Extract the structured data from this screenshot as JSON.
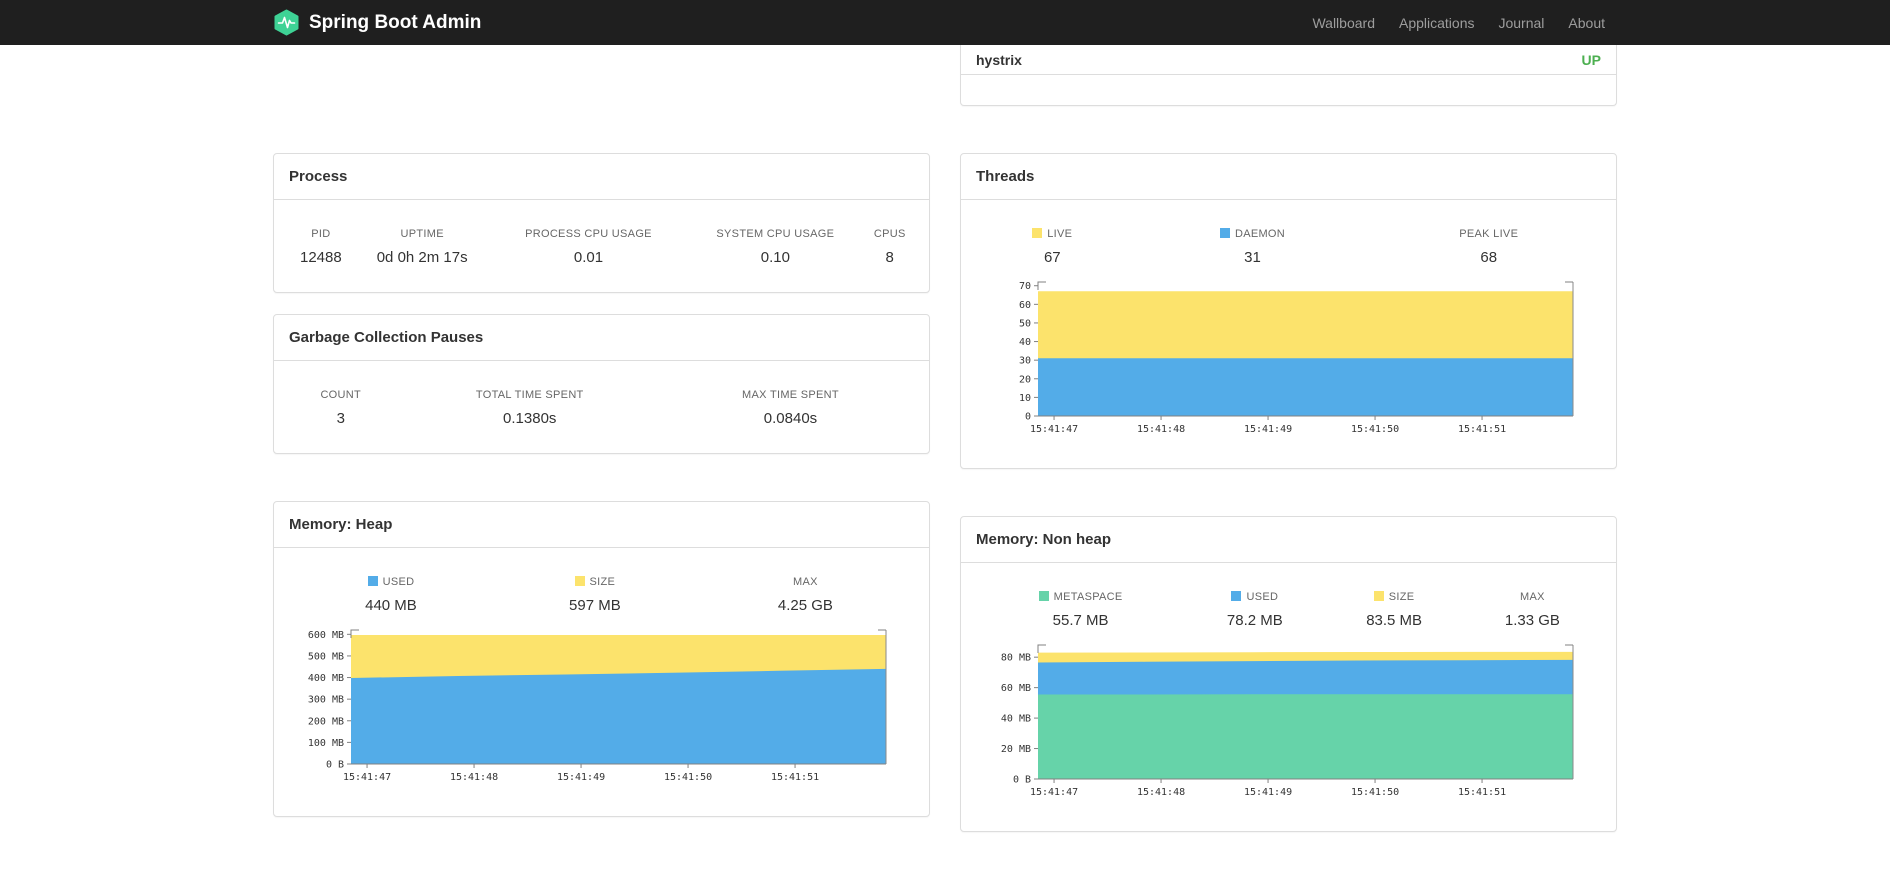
{
  "navbar": {
    "brand": "Spring Boot Admin",
    "brand_color": "#3ed295",
    "items": [
      {
        "label": "Wallboard"
      },
      {
        "label": "Applications"
      },
      {
        "label": "Journal"
      },
      {
        "label": "About"
      }
    ]
  },
  "hystrix_panel": {
    "app_name": "hystrix",
    "status": "UP",
    "status_color": "#4caf50"
  },
  "process": {
    "title": "Process",
    "columns": [
      "PID",
      "UPTIME",
      "PROCESS CPU USAGE",
      "SYSTEM CPU USAGE",
      "CPUS"
    ],
    "values": [
      "12488",
      "0d 0h 2m 17s",
      "0.01",
      "0.10",
      "8"
    ]
  },
  "gc": {
    "title": "Garbage Collection Pauses",
    "columns": [
      "COUNT",
      "TOTAL TIME SPENT",
      "MAX TIME SPENT"
    ],
    "values": [
      "3",
      "0.1380s",
      "0.0840s"
    ]
  },
  "threads": {
    "title": "Threads",
    "legend": [
      {
        "label": "LIVE",
        "value": "67",
        "color": "#fce36c"
      },
      {
        "label": "DAEMON",
        "value": "31",
        "color": "#53ace8"
      },
      {
        "label": "PEAK LIVE",
        "value": "68"
      }
    ]
  },
  "memory_heap": {
    "title": "Memory: Heap",
    "legend": [
      {
        "label": "USED",
        "value": "440 MB",
        "color": "#53ace8"
      },
      {
        "label": "SIZE",
        "value": "597 MB",
        "color": "#fce36c"
      },
      {
        "label": "MAX",
        "value": "4.25 GB"
      }
    ]
  },
  "memory_nonheap": {
    "title": "Memory: Non heap",
    "legend": [
      {
        "label": "METASPACE",
        "value": "55.7 MB",
        "color": "#66d3a9"
      },
      {
        "label": "USED",
        "value": "78.2 MB",
        "color": "#53ace8"
      },
      {
        "label": "SIZE",
        "value": "83.5 MB",
        "color": "#fce36c"
      },
      {
        "label": "MAX",
        "value": "1.33 GB"
      }
    ]
  },
  "chart_data": [
    {
      "id": "threads-chart",
      "type": "area",
      "title": "Threads",
      "stacking": "layered",
      "x_labels": [
        "15:41:47",
        "15:41:48",
        "15:41:49",
        "15:41:50",
        "15:41:51"
      ],
      "ymax": 72,
      "y_ticks": [
        {
          "v": 0,
          "label": "0"
        },
        {
          "v": 10,
          "label": "10"
        },
        {
          "v": 20,
          "label": "20"
        },
        {
          "v": 30,
          "label": "30"
        },
        {
          "v": 40,
          "label": "40"
        },
        {
          "v": 50,
          "label": "50"
        },
        {
          "v": 60,
          "label": "60"
        },
        {
          "v": 70,
          "label": "70"
        }
      ],
      "series": [
        {
          "name": "LIVE",
          "color": "#fce36c",
          "values": [
            67,
            67,
            67,
            67,
            67,
            67
          ]
        },
        {
          "name": "DAEMON",
          "color": "#53ace8",
          "values": [
            31,
            31,
            31,
            31,
            31,
            31
          ]
        }
      ]
    },
    {
      "id": "memory-heap-chart",
      "type": "area",
      "title": "Memory: Heap",
      "stacking": "layered",
      "x_labels": [
        "15:41:47",
        "15:41:48",
        "15:41:49",
        "15:41:50",
        "15:41:51"
      ],
      "ymax": 620,
      "y_ticks": [
        {
          "v": 0,
          "label": "0 B"
        },
        {
          "v": 100,
          "label": "100 MB"
        },
        {
          "v": 200,
          "label": "200 MB"
        },
        {
          "v": 300,
          "label": "300 MB"
        },
        {
          "v": 400,
          "label": "400 MB"
        },
        {
          "v": 500,
          "label": "500 MB"
        },
        {
          "v": 600,
          "label": "600 MB"
        }
      ],
      "series": [
        {
          "name": "SIZE",
          "color": "#fce36c",
          "values": [
            597,
            597,
            597,
            597,
            597,
            597
          ]
        },
        {
          "name": "USED",
          "color": "#53ace8",
          "values": [
            398,
            407,
            414,
            422,
            431,
            440
          ]
        }
      ]
    },
    {
      "id": "memory-nonheap-chart",
      "type": "area",
      "title": "Memory: Non heap",
      "stacking": "layered",
      "x_labels": [
        "15:41:47",
        "15:41:48",
        "15:41:49",
        "15:41:50",
        "15:41:51"
      ],
      "ymax": 88,
      "y_ticks": [
        {
          "v": 0,
          "label": "0 B"
        },
        {
          "v": 20,
          "label": "20 MB"
        },
        {
          "v": 40,
          "label": "40 MB"
        },
        {
          "v": 60,
          "label": "60 MB"
        },
        {
          "v": 80,
          "label": "80 MB"
        }
      ],
      "series": [
        {
          "name": "SIZE",
          "color": "#fce36c",
          "values": [
            83.0,
            83.1,
            83.3,
            83.4,
            83.5,
            83.5
          ]
        },
        {
          "name": "USED",
          "color": "#53ace8",
          "values": [
            76.5,
            77.0,
            77.4,
            77.8,
            78.0,
            78.2
          ]
        },
        {
          "name": "METASPACE",
          "color": "#66d3a9",
          "values": [
            55.5,
            55.5,
            55.6,
            55.6,
            55.7,
            55.7
          ]
        }
      ]
    }
  ]
}
